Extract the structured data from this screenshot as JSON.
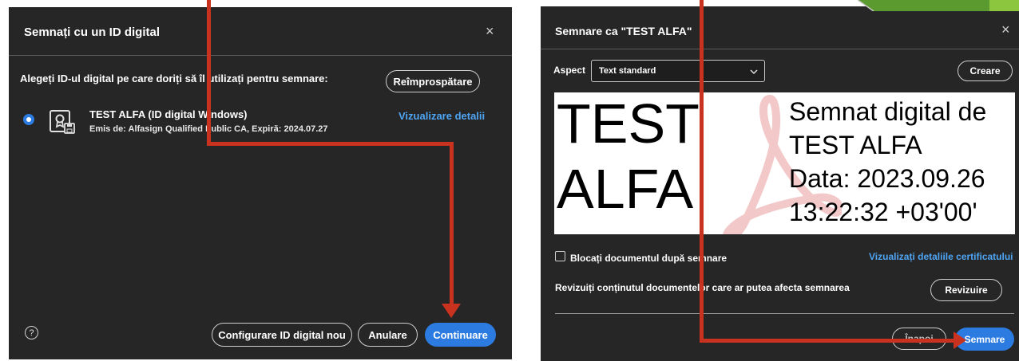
{
  "dialog1": {
    "title": "Semnați cu un ID digital",
    "close": "×",
    "prompt": "Alegeți ID-ul digital pe care doriți să îl utilizați pentru semnare:",
    "refresh_label": "Reîmprospătare",
    "id_name": "TEST ALFA (ID digital Windows)",
    "id_issuer": "Emis de: Alfasign Qualified Public CA, Expiră: 2024.07.27",
    "details_link": "Vizualizare detalii",
    "help": "?",
    "configure_label": "Configurare ID digital nou",
    "cancel_label": "Anulare",
    "continue_label": "Continuare"
  },
  "dialog2": {
    "title": "Semnare ca \"TEST ALFA\"",
    "close": "×",
    "aspect_label": "Aspect",
    "aspect_value": "Text standard",
    "create_label": "Creare",
    "preview": {
      "name_line1": "TEST",
      "name_line2": "ALFA",
      "line1": "Semnat digital de",
      "line2": "TEST ALFA",
      "line3": "Data: 2023.09.26",
      "line4": "13:22:32 +03'00'"
    },
    "lock_label": "Blocați documentul după semnare",
    "cert_link": "Vizualizați detaliile certificatului",
    "review_text": "Revizuiți conținutul documentelor care ar putea afecta semnarea",
    "review_label": "Revizuire",
    "back_label": "Înapoi",
    "sign_label": "Semnare"
  },
  "colors": {
    "dialog_bg": "#262626",
    "accent_blue": "#2c7be0",
    "link_blue": "#4ea5f5",
    "annotation_arrow": "#c9321f"
  }
}
